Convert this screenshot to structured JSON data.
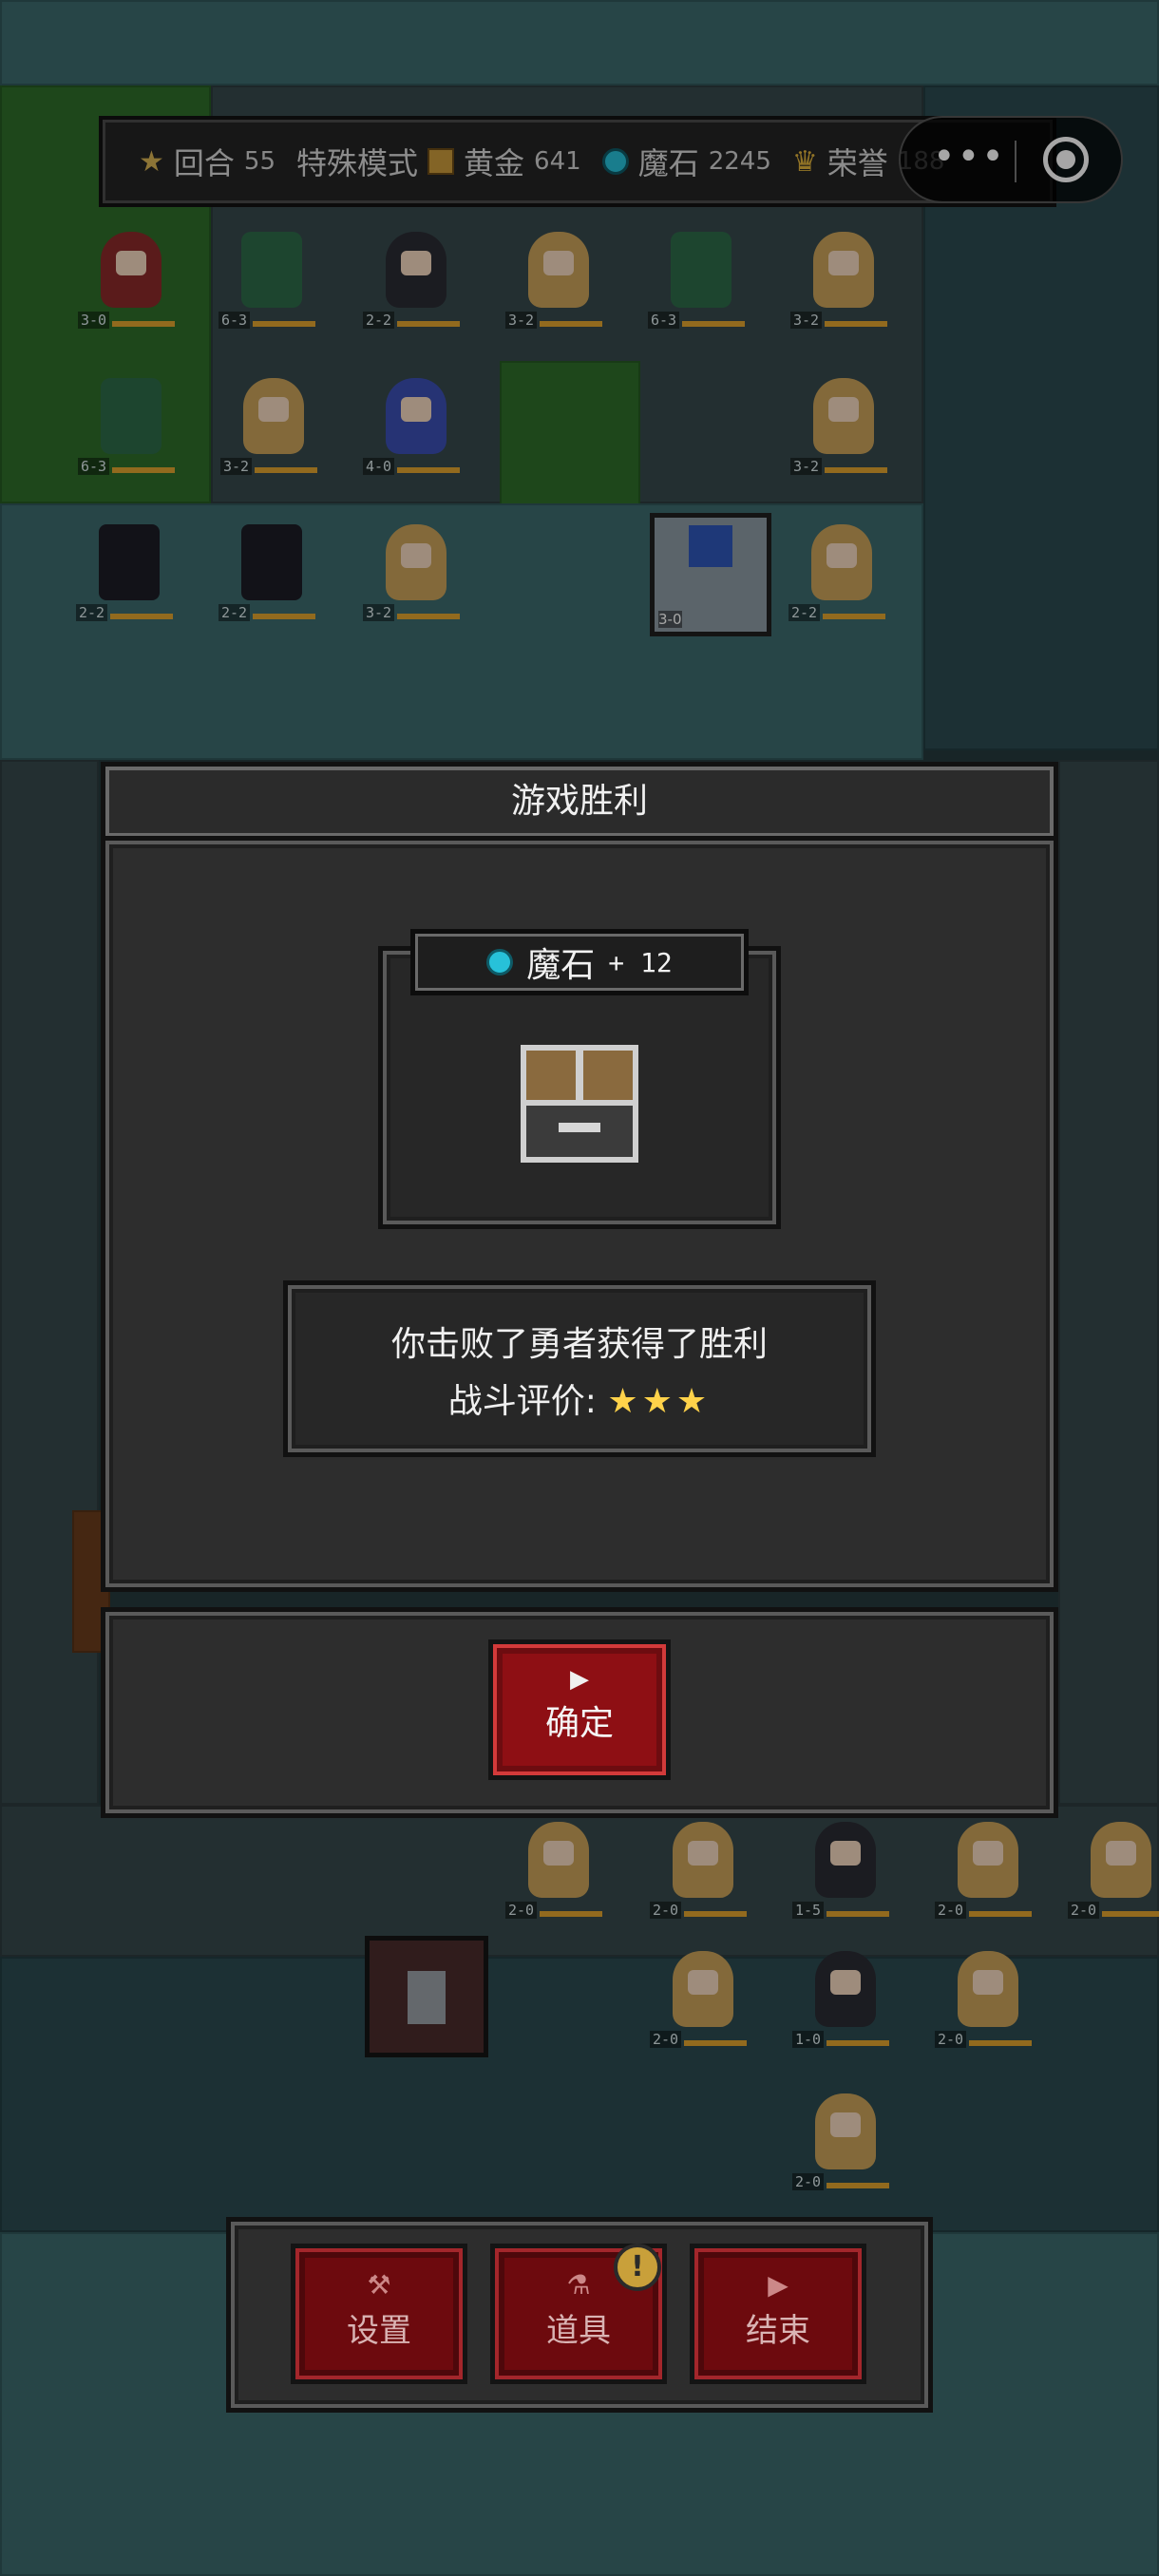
{
  "hud": {
    "round_label": "回合",
    "round_value": "55",
    "mode_label": "特殊模式",
    "gold_label": "黄金",
    "gold_value": "641",
    "magic_stone_label": "魔石",
    "magic_stone_value": "2245",
    "honor_label": "荣誉",
    "honor_value": "188"
  },
  "capsule": {
    "more_label": "•••"
  },
  "dialog": {
    "title": "游戏胜利",
    "reward_name": "魔石",
    "reward_amount": "+ 12",
    "message": "你击败了勇者获得了胜利",
    "rating_label": "战斗评价:",
    "rating_stars": "★★★",
    "confirm_label": "确定"
  },
  "toolbar": {
    "settings_label": "设置",
    "items_label": "道具",
    "items_badge": "!",
    "end_label": "结束"
  },
  "map_units": [
    {
      "type": "witch",
      "level": "3-0"
    },
    {
      "type": "dragon",
      "level": "6-3"
    },
    {
      "type": "nun",
      "level": "2-2"
    },
    {
      "type": "elf",
      "level": "3-2"
    },
    {
      "type": "dragon",
      "level": "6-3"
    },
    {
      "type": "elf",
      "level": "3-2"
    },
    {
      "type": "dragon",
      "level": "6-3"
    },
    {
      "type": "elf",
      "level": "3-2"
    },
    {
      "type": "king",
      "level": "4-0"
    },
    {
      "type": "elf",
      "level": "3-2"
    },
    {
      "type": "bat",
      "level": "2-2"
    },
    {
      "type": "bat",
      "level": "2-2"
    },
    {
      "type": "elf",
      "level": "3-2"
    },
    {
      "type": "elf",
      "level": "2-2"
    },
    {
      "type": "elf",
      "level": "2-0"
    },
    {
      "type": "elf",
      "level": "2-0"
    },
    {
      "type": "nun",
      "level": "1-5"
    },
    {
      "type": "elf",
      "level": "2-0"
    },
    {
      "type": "elf",
      "level": "2-0"
    },
    {
      "type": "elf",
      "level": "2-0"
    },
    {
      "type": "nun",
      "level": "1-0"
    },
    {
      "type": "elf",
      "level": "2-0"
    },
    {
      "type": "elf",
      "level": "2-0"
    }
  ]
}
